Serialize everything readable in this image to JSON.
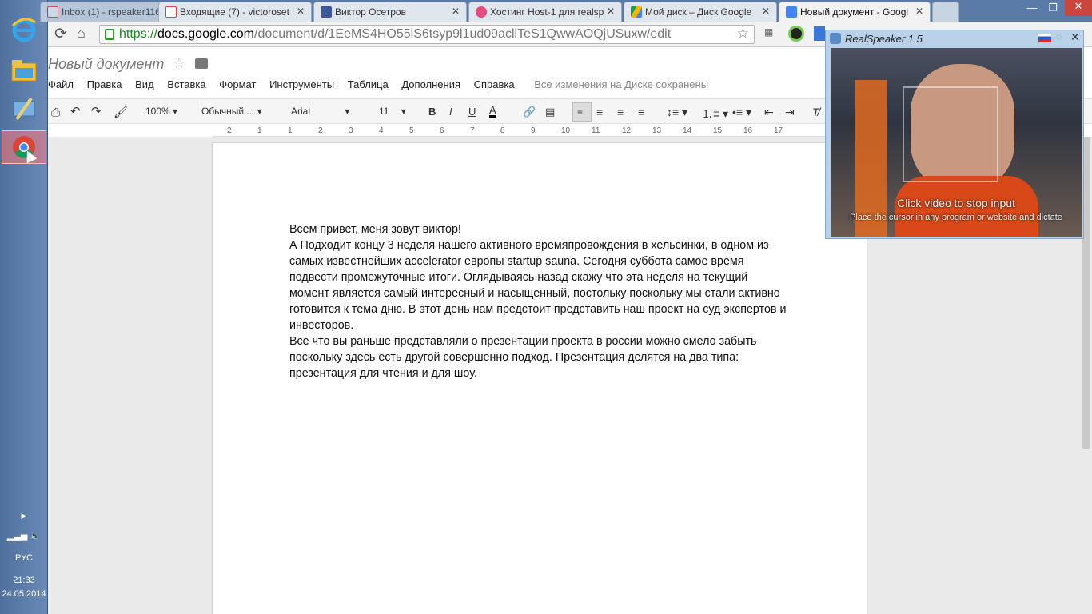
{
  "taskbar": {
    "language": "РУС",
    "time": "21:33",
    "date": "24.05.2014"
  },
  "tabs": [
    {
      "label": "Inbox (1) - rspeaker116@g",
      "icon": "gmail-icon"
    },
    {
      "label": "Входящие (7) - victoroset",
      "icon": "gmail-icon"
    },
    {
      "label": "Виктор Осетров",
      "icon": "facebook-icon"
    },
    {
      "label": "Хостинг Host-1 для realsp",
      "icon": "hosting-icon"
    },
    {
      "label": "Мой диск – Диск Google",
      "icon": "drive-icon"
    },
    {
      "label": "Новый документ - Googl",
      "icon": "docs-icon"
    }
  ],
  "address": {
    "scheme": "https://",
    "host": "docs.google.com",
    "path": "/document/d/1EeMS4HO55lS6tsyp9l1ud09acllTeS1QwwAOQjUSuxw/edit"
  },
  "docs": {
    "title": "Новый документ",
    "menu": [
      "Файл",
      "Правка",
      "Вид",
      "Вставка",
      "Формат",
      "Инструменты",
      "Таблица",
      "Дополнения",
      "Справка"
    ],
    "save_status": "Все изменения на Диске сохранены",
    "zoom": "100%",
    "style": "Обычный ...",
    "font": "Arial",
    "font_size": "11",
    "ruler_numbers": [
      "2",
      "1",
      "1",
      "2",
      "3",
      "4",
      "5",
      "6",
      "7",
      "8",
      "9",
      "10",
      "11",
      "12",
      "13",
      "14",
      "15",
      "16",
      "17"
    ],
    "paragraphs": [
      "Всем привет, меня зовут виктор!",
      "А Подходит концу 3 неделя нашего активного времяпровождения в хельсинки, в одном из самых известнейших accelerator европы startup sauna. Сегодня суббота самое время подвести промежуточные итоги. Оглядываясь назад скажу что эта неделя на текущий момент является самый интересный и насыщенный, постольку поскольку мы стали активно готовится к тема дню. В этот день нам предстоит представить наш проект на суд экспертов и инвесторов.",
      "Все что вы раньше представляли о презентации проекта в россии можно смело забыть поскольку здесь есть другой совершенно подход. Презентация делятся на два типа: презентация для чтения и для шоу."
    ]
  },
  "realspeaker": {
    "title": "RealSpeaker 1.5",
    "hint1": "Click video to stop input",
    "hint2": "Place the cursor in any program or website and dictate"
  },
  "colors": {
    "accent_green": "#1a8a1a",
    "taskbar": "#5a7aa8",
    "active_taskbar_app": "#f28a8a"
  }
}
